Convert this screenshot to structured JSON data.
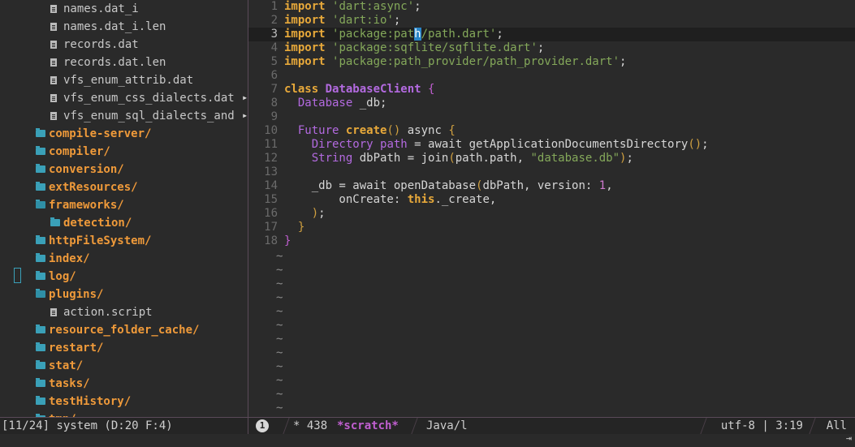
{
  "tree": {
    "items": [
      {
        "type": "file",
        "label": "names.dat_i",
        "indent": 2
      },
      {
        "type": "file",
        "label": "names.dat_i.len",
        "indent": 2
      },
      {
        "type": "file",
        "label": "records.dat",
        "indent": 2
      },
      {
        "type": "file",
        "label": "records.dat.len",
        "indent": 2
      },
      {
        "type": "file",
        "label": "vfs_enum_attrib.dat",
        "indent": 2
      },
      {
        "type": "file",
        "label": "vfs_enum_css_dialects.dat",
        "indent": 2
      },
      {
        "type": "file",
        "label": "vfs_enum_sql_dialects_and",
        "indent": 2
      },
      {
        "type": "dir",
        "label": "compile-server/",
        "indent": 1
      },
      {
        "type": "dir",
        "label": "compiler/",
        "indent": 1
      },
      {
        "type": "dir",
        "label": "conversion/",
        "indent": 1
      },
      {
        "type": "dir",
        "label": "extResources/",
        "indent": 1
      },
      {
        "type": "dir",
        "label": "frameworks/",
        "indent": 1,
        "open": true
      },
      {
        "type": "dir",
        "label": "detection/",
        "indent": 2
      },
      {
        "type": "dir",
        "label": "httpFileSystem/",
        "indent": 1
      },
      {
        "type": "dir",
        "label": "index/",
        "indent": 1
      },
      {
        "type": "dir",
        "label": "log/",
        "indent": 1
      },
      {
        "type": "dir",
        "label": "plugins/",
        "indent": 1,
        "open": true
      },
      {
        "type": "file",
        "label": "action.script",
        "indent": 2
      },
      {
        "type": "dir",
        "label": "resource_folder_cache/",
        "indent": 1
      },
      {
        "type": "dir",
        "label": "restart/",
        "indent": 1
      },
      {
        "type": "dir",
        "label": "stat/",
        "indent": 1
      },
      {
        "type": "dir",
        "label": "tasks/",
        "indent": 1
      },
      {
        "type": "dir",
        "label": "testHistory/",
        "indent": 1
      },
      {
        "type": "dir",
        "label": "tmp/",
        "indent": 1
      }
    ],
    "truncation_marker_1": "▸",
    "truncation_marker_2": "▸"
  },
  "editor": {
    "current_line": 3,
    "lines": [
      {
        "n": "1",
        "tokens": [
          [
            "kw",
            "import"
          ],
          [
            "plain",
            " "
          ],
          [
            "str",
            "'dart:async'"
          ],
          [
            "plain",
            ";"
          ]
        ]
      },
      {
        "n": "2",
        "tokens": [
          [
            "kw",
            "import"
          ],
          [
            "plain",
            " "
          ],
          [
            "str",
            "'dart:io'"
          ],
          [
            "plain",
            ";"
          ]
        ]
      },
      {
        "n": "3",
        "tokens": [
          [
            "kw",
            "import"
          ],
          [
            "plain",
            " "
          ],
          [
            "str",
            "'package:pat"
          ],
          [
            "cur",
            "h"
          ],
          [
            "str",
            "/path.dart'"
          ],
          [
            "plain",
            ";"
          ]
        ]
      },
      {
        "n": "4",
        "tokens": [
          [
            "kw",
            "import"
          ],
          [
            "plain",
            " "
          ],
          [
            "str",
            "'package:sqflite/sqflite.dart'"
          ],
          [
            "plain",
            ";"
          ]
        ]
      },
      {
        "n": "5",
        "tokens": [
          [
            "kw",
            "import"
          ],
          [
            "plain",
            " "
          ],
          [
            "str",
            "'package:path_provider/path_provider.dart'"
          ],
          [
            "plain",
            ";"
          ]
        ]
      },
      {
        "n": "6",
        "tokens": []
      },
      {
        "n": "7",
        "tokens": [
          [
            "kw",
            "class"
          ],
          [
            "plain",
            " "
          ],
          [
            "cls",
            "DatabaseClient"
          ],
          [
            "plain",
            " "
          ],
          [
            "brace",
            "{"
          ]
        ]
      },
      {
        "n": "8",
        "tokens": [
          [
            "plain",
            "  "
          ],
          [
            "typ",
            "Database"
          ],
          [
            "plain",
            " _db;"
          ]
        ]
      },
      {
        "n": "9",
        "tokens": []
      },
      {
        "n": "10",
        "tokens": [
          [
            "plain",
            "  "
          ],
          [
            "typ",
            "Future"
          ],
          [
            "plain",
            " "
          ],
          [
            "kw",
            "create"
          ],
          [
            "paren",
            "()"
          ],
          [
            "plain",
            " async "
          ],
          [
            "paren",
            "{"
          ]
        ]
      },
      {
        "n": "11",
        "tokens": [
          [
            "plain",
            "    "
          ],
          [
            "typ",
            "Directory"
          ],
          [
            "plain",
            " "
          ],
          [
            "typ",
            "path"
          ],
          [
            "plain",
            " = await getApplicationDocumentsDirectory"
          ],
          [
            "paren",
            "()"
          ],
          [
            "plain",
            ";"
          ]
        ]
      },
      {
        "n": "12",
        "tokens": [
          [
            "plain",
            "    "
          ],
          [
            "typ",
            "String"
          ],
          [
            "plain",
            " dbPath = join"
          ],
          [
            "paren",
            "("
          ],
          [
            "plain",
            "path.path, "
          ],
          [
            "str",
            "\"database.db\""
          ],
          [
            "paren",
            ")"
          ],
          [
            "plain",
            ";"
          ]
        ]
      },
      {
        "n": "13",
        "tokens": []
      },
      {
        "n": "14",
        "tokens": [
          [
            "plain",
            "    _db = await openDatabase"
          ],
          [
            "paren",
            "("
          ],
          [
            "plain",
            "dbPath, version: "
          ],
          [
            "num",
            "1"
          ],
          [
            "plain",
            ","
          ]
        ]
      },
      {
        "n": "15",
        "tokens": [
          [
            "plain",
            "        onCreate: "
          ],
          [
            "kw",
            "this"
          ],
          [
            "plain",
            "._create,"
          ]
        ]
      },
      {
        "n": "16",
        "tokens": [
          [
            "plain",
            "    "
          ],
          [
            "paren",
            ")"
          ],
          [
            "plain",
            ";"
          ]
        ]
      },
      {
        "n": "17",
        "tokens": [
          [
            "plain",
            "  "
          ],
          [
            "paren",
            "}"
          ]
        ]
      },
      {
        "n": "18",
        "tokens": [
          [
            "brace",
            "}"
          ]
        ]
      }
    ],
    "tilde": "~",
    "tilde_count": 12
  },
  "status": {
    "left": "[11/24] system (D:20 F:4)",
    "window_number": "1",
    "modified": "* 438",
    "buffer_name": "*scratch*",
    "mode": "Java/l",
    "encoding_pos": "utf-8 | 3:19",
    "scroll": "All"
  },
  "minibuffer": {
    "arrow": "⇥"
  }
}
